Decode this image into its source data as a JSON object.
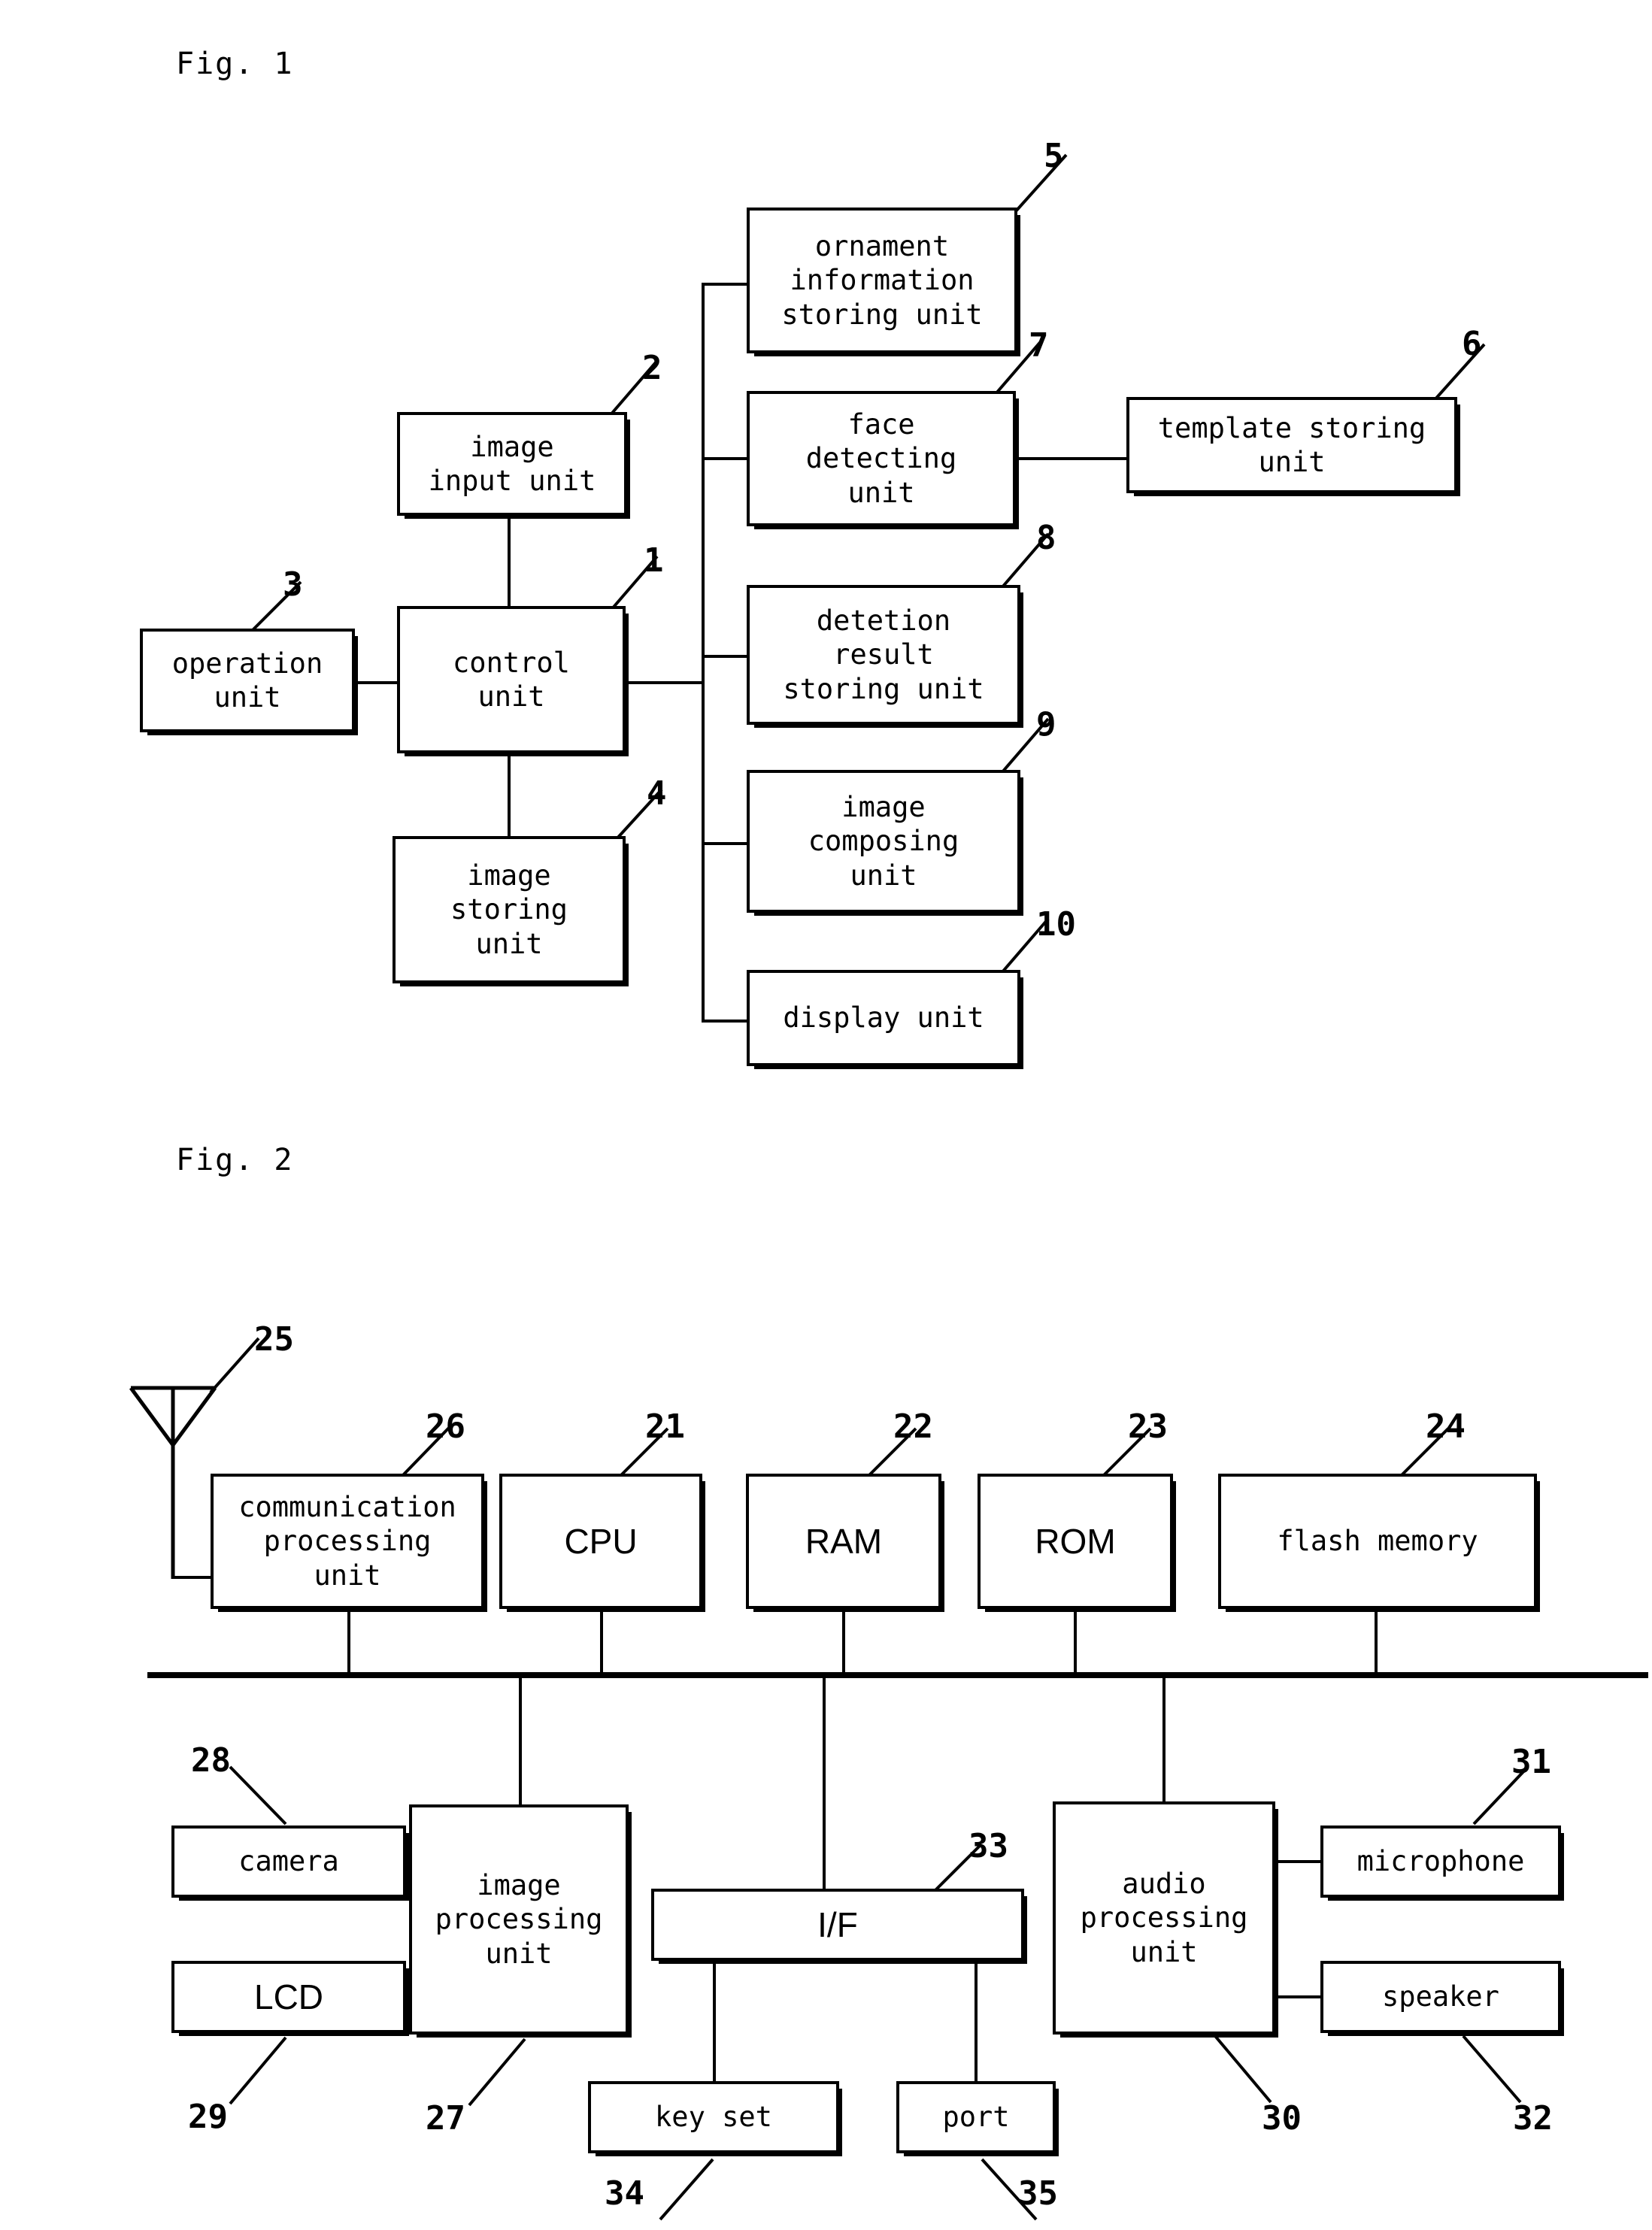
{
  "figures": [
    {
      "id": "fig1",
      "caption": "Fig. 1"
    },
    {
      "id": "fig2",
      "caption": "Fig. 2"
    }
  ],
  "fig1": {
    "caption": "Fig. 1",
    "blocks": [
      {
        "key": "control_unit",
        "ref": "1",
        "label": "control\nunit"
      },
      {
        "key": "image_input_unit",
        "ref": "2",
        "label": "image\ninput unit"
      },
      {
        "key": "operation_unit",
        "ref": "3",
        "label": "operation\nunit"
      },
      {
        "key": "image_storing_unit",
        "ref": "4",
        "label": "image\nstoring\nunit"
      },
      {
        "key": "ornament_info_unit",
        "ref": "5",
        "label": "ornament\ninformation\nstoring unit"
      },
      {
        "key": "template_storing_unit",
        "ref": "6",
        "label": "template storing\nunit"
      },
      {
        "key": "face_detecting_unit",
        "ref": "7",
        "label": "face\ndetecting\nunit"
      },
      {
        "key": "detetion_result_unit",
        "ref": "8",
        "label": "detetion\nresult\nstoring unit"
      },
      {
        "key": "image_composing_unit",
        "ref": "9",
        "label": "image\ncomposing\nunit"
      },
      {
        "key": "display_unit",
        "ref": "10",
        "label": "display unit"
      }
    ]
  },
  "fig2": {
    "caption": "Fig. 2",
    "blocks": [
      {
        "key": "antenna",
        "ref": "25",
        "label": ""
      },
      {
        "key": "communication_unit",
        "ref": "26",
        "label": "communication\nprocessing\nunit"
      },
      {
        "key": "cpu",
        "ref": "21",
        "label": "CPU"
      },
      {
        "key": "ram",
        "ref": "22",
        "label": "RAM"
      },
      {
        "key": "rom",
        "ref": "23",
        "label": "ROM"
      },
      {
        "key": "flash_memory",
        "ref": "24",
        "label": "flash memory"
      },
      {
        "key": "camera",
        "ref": "28",
        "label": "camera"
      },
      {
        "key": "lcd",
        "ref": "29",
        "label": "LCD"
      },
      {
        "key": "image_processing_unit",
        "ref": "27",
        "label": "image\nprocessing\nunit"
      },
      {
        "key": "interface",
        "ref": "33",
        "label": "I/F"
      },
      {
        "key": "key_set",
        "ref": "34",
        "label": "key set"
      },
      {
        "key": "port",
        "ref": "35",
        "label": "port"
      },
      {
        "key": "audio_processing_unit",
        "ref": "30",
        "label": "audio\nprocessing\nunit"
      },
      {
        "key": "microphone",
        "ref": "31",
        "label": "microphone"
      },
      {
        "key": "speaker",
        "ref": "32",
        "label": "speaker"
      }
    ]
  },
  "colors": {
    "ink": "#000000",
    "paper": "#ffffff"
  }
}
